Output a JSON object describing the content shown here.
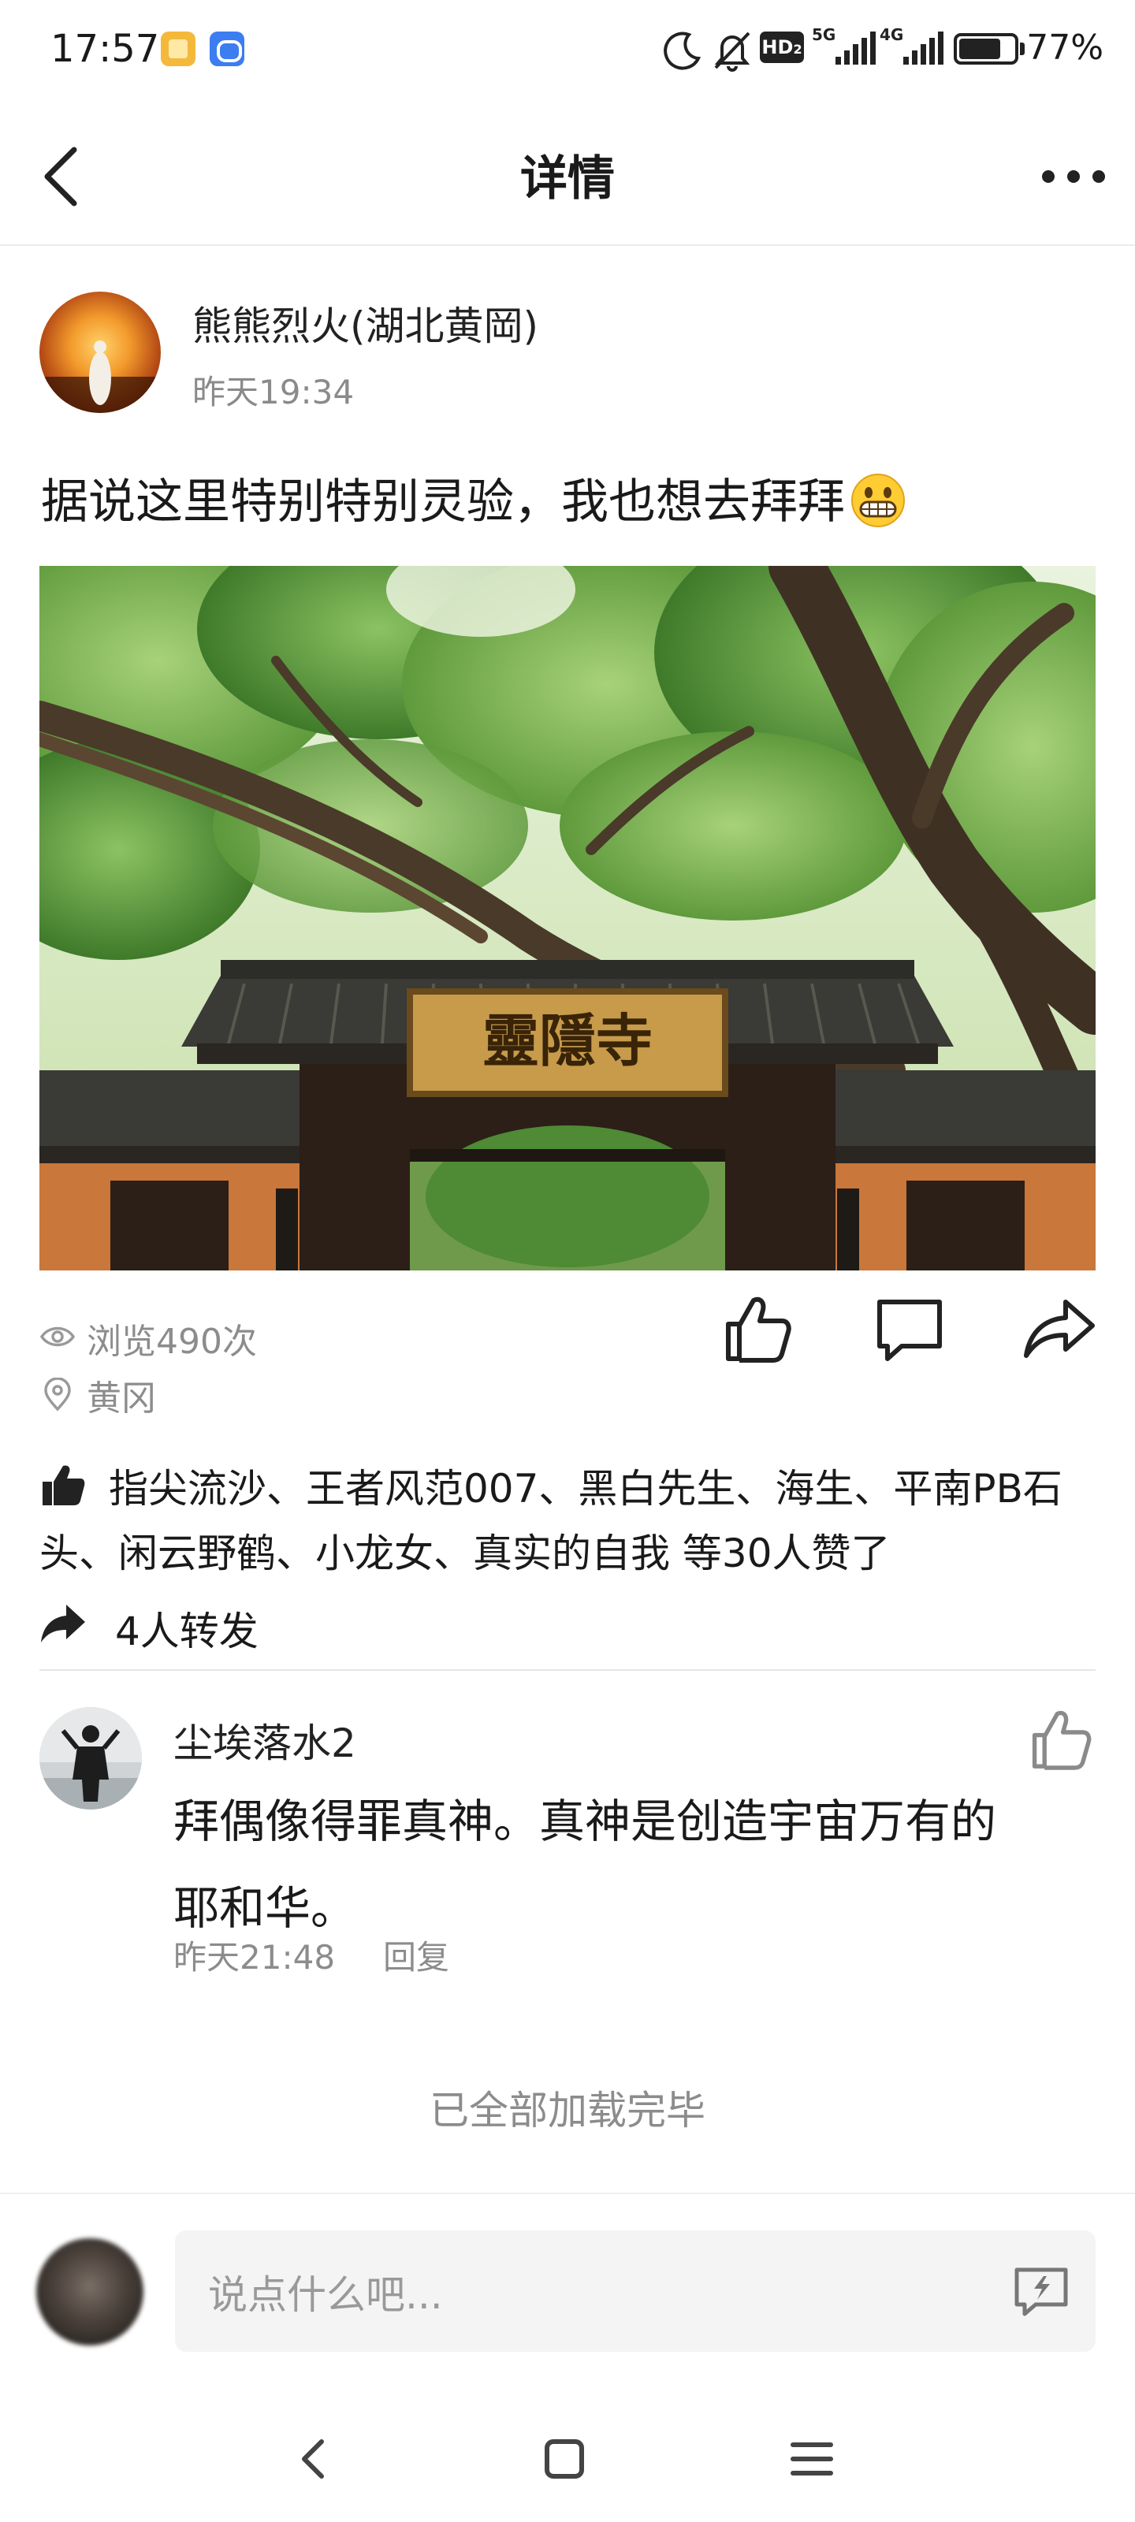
{
  "status_bar": {
    "time": "17:57",
    "app_icons": [
      "notes-app-icon",
      "chat-app-icon"
    ],
    "indicators": [
      "moon-icon",
      "mute-bell-icon",
      "hd-icon",
      "5g-signal-icon",
      "4g-signal-icon",
      "battery-icon"
    ],
    "hd_label": "HD",
    "hd_sub": "2",
    "net_5g": "5G",
    "net_4g": "4G",
    "battery_level": 0.77,
    "battery_label": "77%"
  },
  "nav": {
    "title": "详情",
    "back_icon": "chevron-left-icon",
    "more_icon": "more-dots-icon"
  },
  "post": {
    "author": "熊熊烈火(湖北黄岡)",
    "time": "昨天19:34",
    "text": "据说这里特别特别灵验，我也想去拜拜",
    "emoji": "grinning-face-emoji",
    "photo_plaque": "靈隱寺",
    "views": "浏览490次",
    "location": "黄冈",
    "actions": [
      "thumbs-up-icon",
      "comment-icon",
      "share-icon"
    ]
  },
  "likes": {
    "text": "指尖流沙、王者风范007、黑白先生、海生、平南PB石头、闲云野鹤、小龙女、真实的自我 等30人赞了"
  },
  "shares": {
    "text": "4人转发"
  },
  "comments": [
    {
      "name": "尘埃落水2",
      "text": "拜偶像得罪真神。真神是创造宇宙万有的耶和华。",
      "time": "昨天21:48",
      "reply_label": "回复"
    }
  ],
  "footer_status": "已全部加载完毕",
  "input": {
    "placeholder": "说点什么吧..."
  },
  "system_nav": [
    "back-nav-icon",
    "home-nav-icon",
    "menu-nav-icon"
  ],
  "colors": {
    "text_primary": "#1a1a1a",
    "text_secondary": "#8c8c8c",
    "divider": "#e6e6e6",
    "input_bg": "#f4f4f4"
  }
}
